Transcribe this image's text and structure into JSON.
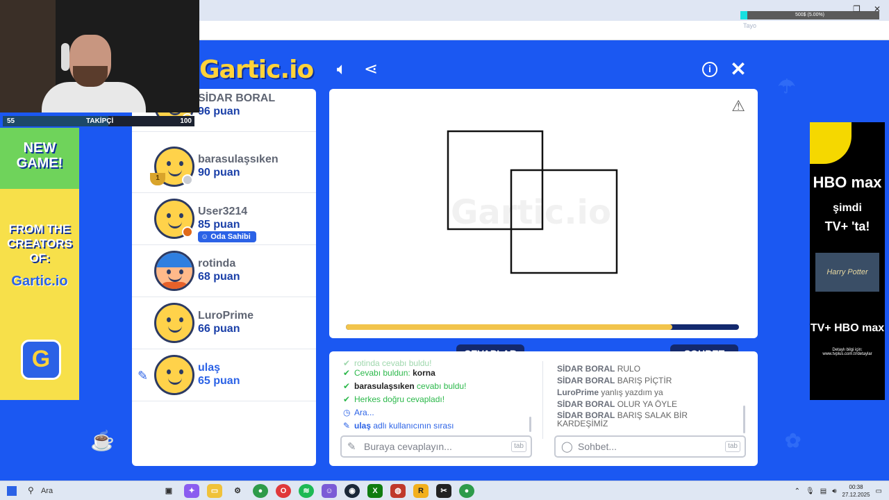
{
  "browser": {
    "stream_overlay": {
      "label": "500$ (5.00%)",
      "progress_percent": 5.0
    },
    "faded_tab_text": "Tayo"
  },
  "header": {
    "logo": "Gartic.io",
    "icons": [
      "sound-icon",
      "share-icon",
      "info-icon",
      "close-icon"
    ]
  },
  "players": [
    {
      "name": "SİDAR BORAL",
      "score": "96 puan",
      "status": "yellow"
    },
    {
      "name": "barasulaşsıken",
      "score": "90 puan",
      "status": "grey",
      "trophy": "1"
    },
    {
      "name": "User3214",
      "score": "85 puan",
      "status": "orange",
      "badge": "Oda Sahibi"
    },
    {
      "name": "rotinda",
      "score": "68 puan"
    },
    {
      "name": "LuroPrime",
      "score": "66 puan"
    },
    {
      "name": "ulaş",
      "score": "65 puan",
      "drawing": true
    }
  ],
  "canvas": {
    "watermark": "Gartic.io",
    "timer_remaining_fraction": 0.83
  },
  "tabs": {
    "answers": "CEVAPLAR",
    "chat": "SOHBET"
  },
  "answers": {
    "faded_line": "rotinda cevabı buldu!",
    "lines": [
      {
        "pre": "Cevabı buldun: ",
        "bold": "korna",
        "post": ""
      },
      {
        "pre": "",
        "bold": "barasulaşsıken",
        "post": " cevabı buldu!"
      },
      {
        "pre": "Herkes doğru cevapladı!",
        "bold": "",
        "post": ""
      },
      {
        "pre": "Ara...",
        "bold": "",
        "post": ""
      },
      {
        "pre": "",
        "bold": "ulaş",
        "post": " adlı kullanıcının sırası"
      }
    ],
    "input_placeholder": "Buraya cevaplayın...",
    "tab_key": "tab"
  },
  "chat": {
    "lines": [
      {
        "user": "SİDAR BORAL",
        "text": "RULO"
      },
      {
        "user": "SİDAR BORAL",
        "text": "BARIŞ PİÇTİR"
      },
      {
        "user": "LuroPrime",
        "text": "yanlış yazdım ya"
      },
      {
        "user": "SİDAR BORAL",
        "text": "OLUR YA ÖYLE"
      },
      {
        "user": "SİDAR BORAL",
        "text": "BARIŞ SALAK BİR KARDEŞİMİZ"
      }
    ],
    "input_placeholder": "Sohbet...",
    "tab_key": "tab"
  },
  "left_ad": {
    "line1": "NEW GAME!",
    "line2": "FROM THE CREATORS OF:",
    "logo": "Gartic.io",
    "icon": "G"
  },
  "right_ad": {
    "brand1": "HBO max",
    "line1": "şimdi",
    "line2": "TV+ 'ta!",
    "poster": "Harry Potter",
    "brand2": "TV+ HBO max",
    "fine": "Detaylı bilgi için: www.tvplus.com.tr/detaylar"
  },
  "webcam": {
    "left_count": "55",
    "center_label": "TAKİPÇİ",
    "right_count": "100",
    "progress_fraction": 0.55
  },
  "taskbar": {
    "search_text": "Ara",
    "time": "00:38",
    "date": "27.12.2025"
  }
}
